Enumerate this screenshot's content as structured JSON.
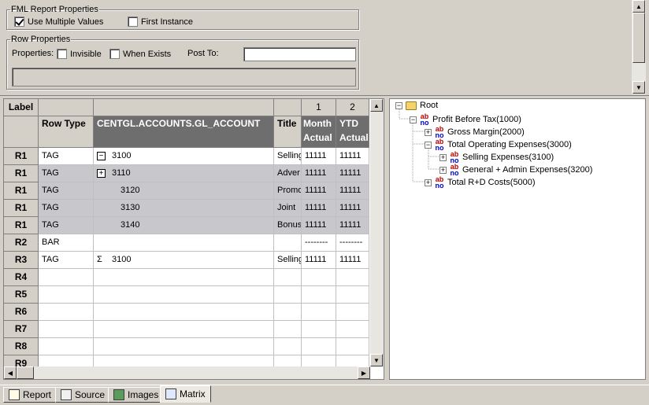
{
  "fml": {
    "legend": "FML Report Properties",
    "use_multiple_values": "Use Multiple Values",
    "first_instance": "First Instance"
  },
  "rowprops": {
    "legend": "Row Properties",
    "properties_label": "Properties:",
    "invisible": "Invisible",
    "when_exists": "When Exists",
    "post_to_label": "Post To:",
    "post_to_value": ""
  },
  "grid": {
    "label_header": "Label",
    "col1_num": "1",
    "col2_num": "2",
    "row_type_header": "Row Type",
    "account_header": "CENTGL.ACCOUNTS.GL_ACCOUNT",
    "title_header": "Title",
    "col1_head1": "Month",
    "col1_head2": "Actual",
    "col2_head1": "YTD",
    "col2_head2": "Actual",
    "rows": [
      {
        "label": "R1",
        "type": "TAG",
        "marker": "minus",
        "account": "3100",
        "title": "Selling",
        "c1": "11111",
        "c2": "11111",
        "grey": false
      },
      {
        "label": "R1",
        "type": "TAG",
        "marker": "plus",
        "account": "3110",
        "title": "Adver",
        "c1": "11111",
        "c2": "11111",
        "grey": true
      },
      {
        "label": "R1",
        "type": "TAG",
        "marker": "",
        "account": "3120",
        "title": "Promo",
        "c1": "11111",
        "c2": "11111",
        "grey": true
      },
      {
        "label": "R1",
        "type": "TAG",
        "marker": "",
        "account": "3130",
        "title": "Joint",
        "c1": "11111",
        "c2": "11111",
        "grey": true
      },
      {
        "label": "R1",
        "type": "TAG",
        "marker": "",
        "account": "3140",
        "title": "Bonus",
        "c1": "11111",
        "c2": "11111",
        "grey": true
      },
      {
        "label": "R2",
        "type": "BAR",
        "marker": "",
        "account": "",
        "title": "",
        "c1": "--------",
        "c2": "--------",
        "grey": false
      },
      {
        "label": "R3",
        "type": "TAG",
        "marker": "sigma",
        "account": "3100",
        "title": "Selling",
        "c1": "11111",
        "c2": "11111",
        "grey": false
      },
      {
        "label": "R4",
        "type": "",
        "marker": "",
        "account": "",
        "title": "",
        "c1": "",
        "c2": "",
        "grey": false
      },
      {
        "label": "R5",
        "type": "",
        "marker": "",
        "account": "",
        "title": "",
        "c1": "",
        "c2": "",
        "grey": false
      },
      {
        "label": "R6",
        "type": "",
        "marker": "",
        "account": "",
        "title": "",
        "c1": "",
        "c2": "",
        "grey": false
      },
      {
        "label": "R7",
        "type": "",
        "marker": "",
        "account": "",
        "title": "",
        "c1": "",
        "c2": "",
        "grey": false
      },
      {
        "label": "R8",
        "type": "",
        "marker": "",
        "account": "",
        "title": "",
        "c1": "",
        "c2": "",
        "grey": false
      },
      {
        "label": "R9",
        "type": "",
        "marker": "",
        "account": "",
        "title": "",
        "c1": "",
        "c2": "",
        "grey": false
      }
    ]
  },
  "tree": {
    "root": "Root",
    "profit": "Profit Before Tax(1000)",
    "gross": "Gross Margin(2000)",
    "opex": "Total Operating Expenses(3000)",
    "selling": "Selling Expenses(3100)",
    "admin": "General + Admin Expenses(3200)",
    "rd": "Total R+D Costs(5000)"
  },
  "tabs": {
    "report": "Report",
    "source": "Source",
    "images": "Images",
    "matrix": "Matrix"
  }
}
